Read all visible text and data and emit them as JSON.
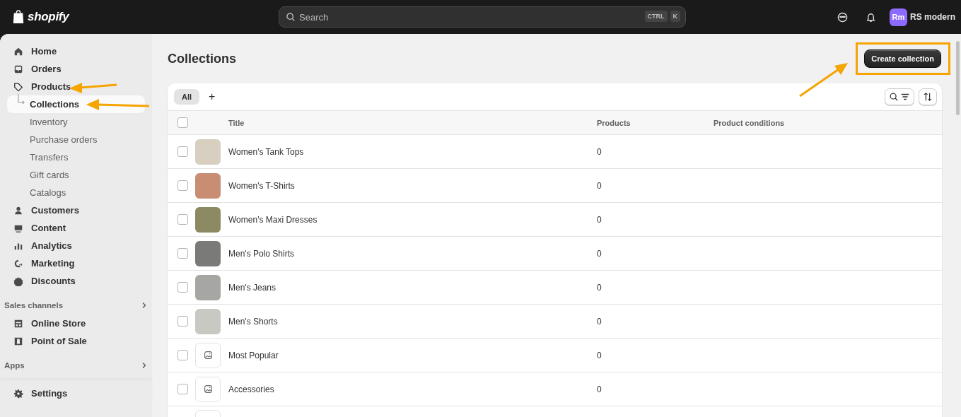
{
  "topbar": {
    "logo": "shopify",
    "search": {
      "placeholder": "Search",
      "shortcut": [
        "CTRL",
        "K"
      ]
    },
    "avatar": "Rm",
    "store": "RS modern"
  },
  "sidebar": {
    "items": [
      {
        "label": "Home",
        "selected": false
      },
      {
        "label": "Orders",
        "selected": false
      },
      {
        "label": "Products",
        "selected": false,
        "expanded": true,
        "children": [
          {
            "label": "Collections",
            "selected": true
          },
          {
            "label": "Inventory",
            "selected": false
          },
          {
            "label": "Purchase orders",
            "selected": false
          },
          {
            "label": "Transfers",
            "selected": false
          },
          {
            "label": "Gift cards",
            "selected": false
          },
          {
            "label": "Catalogs",
            "selected": false
          }
        ]
      },
      {
        "label": "Customers",
        "selected": false
      },
      {
        "label": "Content",
        "selected": false
      },
      {
        "label": "Analytics",
        "selected": false
      },
      {
        "label": "Marketing",
        "selected": false
      },
      {
        "label": "Discounts",
        "selected": false
      }
    ],
    "sections": [
      {
        "title": "Sales channels",
        "items": [
          {
            "label": "Online Store",
            "selected": false
          },
          {
            "label": "Point of Sale",
            "selected": false
          }
        ]
      },
      {
        "title": "Apps"
      }
    ],
    "settings": "Settings"
  },
  "page": {
    "title": "Collections",
    "primary_button": "Create collection"
  },
  "tabs": [
    {
      "label": "All",
      "selected": true
    }
  ],
  "add_tab": "+",
  "table": {
    "all_checked": false,
    "columns": [
      "Title",
      "Products",
      "Product conditions"
    ],
    "rows": [
      {
        "title": "Women's Tank Tops",
        "products": "0",
        "kind": "photo",
        "checked": false
      },
      {
        "title": "Women's T-Shirts",
        "products": "0",
        "kind": "photo",
        "checked": false
      },
      {
        "title": "Women's Maxi Dresses",
        "products": "0",
        "kind": "photo",
        "checked": false
      },
      {
        "title": "Men's Polo Shirts",
        "products": "0",
        "kind": "photo",
        "checked": false
      },
      {
        "title": "Men's Jeans",
        "products": "0",
        "kind": "photo",
        "checked": false
      },
      {
        "title": "Men's Shorts",
        "products": "0",
        "kind": "photo",
        "checked": false
      },
      {
        "title": "Most Popular",
        "products": "0",
        "kind": "placeholder",
        "checked": false
      },
      {
        "title": "Accessories",
        "products": "0",
        "kind": "placeholder",
        "checked": false
      }
    ]
  }
}
